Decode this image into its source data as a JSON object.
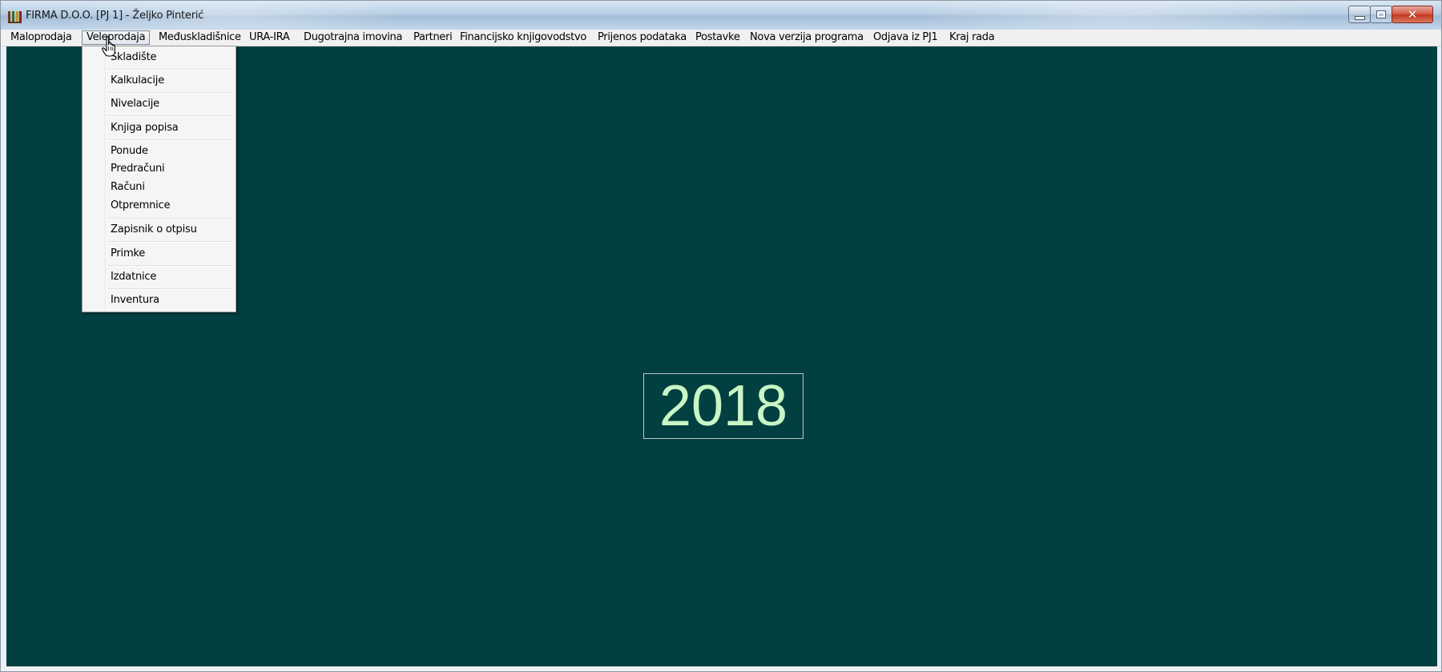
{
  "window": {
    "title": "FIRMA D.O.O. [PJ 1] - Željko Pinterić",
    "icon": "books-icon",
    "caption_icons": [
      "minimize-icon",
      "maximize-icon",
      "close-icon"
    ]
  },
  "menubar": {
    "items": [
      {
        "label": "Maloprodaja"
      },
      {
        "label": "Veleprodaja",
        "active": true
      },
      {
        "label": "Međuskladišnice"
      },
      {
        "label": "URA-IRA"
      },
      {
        "label": "Dugotrajna imovina"
      },
      {
        "label": "Partneri"
      },
      {
        "label": "Financijsko knjigovodstvo"
      },
      {
        "label": "Prijenos podataka"
      },
      {
        "label": "Postavke"
      },
      {
        "label": "Nova verzija programa"
      },
      {
        "label": "Odjava iz PJ1"
      },
      {
        "label": "Kraj rada"
      }
    ]
  },
  "dropdown": {
    "items": [
      "Skladište",
      "Kalkulacije",
      "Nivelacije",
      "Knjiga popisa",
      "Ponude",
      "Predračuni",
      "Računi",
      "Otpremnice",
      "Zapisnik o otpisu",
      "Primke",
      "Izdatnice",
      "Inventura"
    ]
  },
  "desktop": {
    "year": "2018",
    "background_color": "#023f41",
    "year_color": "#c8f6c5"
  }
}
